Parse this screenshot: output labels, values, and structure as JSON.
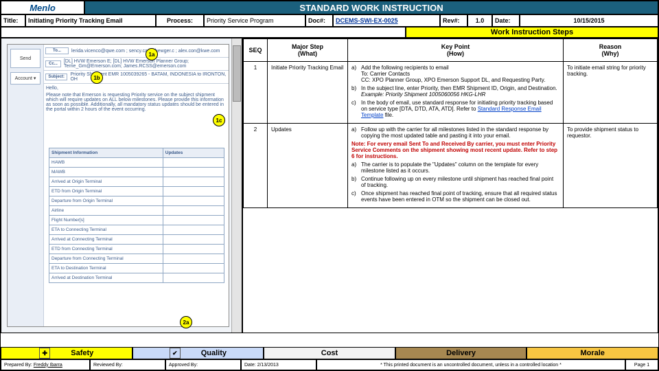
{
  "header": {
    "logo": "Menlo",
    "banner": "STANDARD WORK INSTRUCTION"
  },
  "meta": {
    "title_lbl": "Title:",
    "title": "Initiating Priority Tracking Email",
    "process_lbl": "Process:",
    "process": "Priority Service Program",
    "doc_lbl": "Doc#:",
    "doc": "DCEMS-SWI-EX-0025",
    "rev_lbl": "Rev#:",
    "rev": "1.0",
    "date_lbl": "Date:",
    "date": "10/15/2015"
  },
  "wis": "Work Instruction Steps",
  "cols": {
    "seq": "SEQ",
    "what": "Major Step\n(What)",
    "how": "Key Point\n(How)",
    "why": "Reason\n(Why)"
  },
  "steps": [
    {
      "seq": "1",
      "what": "Initiate Priority Tracking Email",
      "why": "To initiate email string for priority tracking.",
      "how": [
        {
          "l": "a)",
          "t": "Add the following recipients to email\nTo: Carrier Contacts\nCC: XPO Planner Group, XPO Emerson Support DL, and Requesting Party."
        },
        {
          "l": "b)",
          "t": "In the subject line, enter Priority, then EMR Shipment ID, Origin, and Destination.",
          "ex": "Example: Priority Shipment 1005060056 HKG-LHR"
        },
        {
          "l": "c)",
          "t": "In the body of email, use standard response for initiating priority tracking based on service type [DTA, DTD, ATA, ATD]. Refer to ",
          "link": "Standard Response Email Template",
          "t2": " file."
        }
      ]
    },
    {
      "seq": "2",
      "what": "Updates",
      "why": "To provide shipment status to requestor.",
      "how": [
        {
          "l": "a)",
          "t": "Follow up with the carrier for all milestones listed in the standard response by copying the most updated table and pasting it into your email."
        },
        {
          "note": "Note: For every email Sent To and Received By carrier, you must enter Priority Service Comments on the shipment showing most recent update. Refer to step 6 for instructions."
        },
        {
          "l": "a)",
          "t": "The carrier is to populate the \"Updates\" column on the template for every milestone listed as it occurs."
        },
        {
          "l": "b)",
          "t": "Continue following up on every milestone until shipment has reached final point of tracking."
        },
        {
          "l": "c)",
          "t": "Once shipment has reached final point of tracking, ensure that all required status events have been entered in OTM so the shipment can be closed out."
        }
      ]
    }
  ],
  "email": {
    "send": "Send",
    "acct": "Account ▾",
    "to_lbl": "To...",
    "cc_lbl": "Cc...",
    "subj_lbl": "Subject:",
    "to": "lerida.vicenco@qwe.com ; sency.cap@hewger.c ; alex.con@kwe.com",
    "cc": "[DL] HVW Emerson E; [DL] HVW Emerson Planner Group; Terrie_Gm@Emerson.com; James.RCSS@emerson.com",
    "subj": "Priority Shipment EMR 1005039265 - BATAM, INDONESIA to IRONTON, OH",
    "greet": "Hello,",
    "body1": "Please note that Emerson is requesting Priority service on the subject shipment which will require updates on ALL below milestones. Please provide this information as soon as possible. Additionally, all mandatory status updates should be entered in the portal within 2 hours of the event occurring.",
    "mh1": "Shipment Information",
    "mh2": "Updates",
    "ms": [
      "HAWB",
      "MAWB",
      "Arrived at Origin Terminal",
      "ETD from Origin Terminal",
      "Departure from Origin Terminal",
      "Airline",
      "Flight Number[s]",
      "ETA to Connecting Terminal",
      "Arrived at Connecting Terminal",
      "ETD from Connecting Terminal",
      "Departure from Connecting Terminal",
      "ETA to Destination Terminal",
      "Arrived at Destination Terminal"
    ]
  },
  "callouts": {
    "c1a": "1a",
    "c1b": "1b",
    "c1c": "1c",
    "c2a": "2a"
  },
  "pillars": {
    "s": "Safety",
    "q": "Quality",
    "c": "Cost",
    "d": "Delivery",
    "m": "Morale"
  },
  "sig": {
    "prep_l": "Prepared By:",
    "prep": "Freddy Ibarra",
    "rev_l": "Reviewed By:",
    "app_l": "Approved By:",
    "dt_l": "Date:",
    "dt": "2/13/2013",
    "disc": "* This printed document is an uncontrolled document, unless in a controlled location *",
    "page": "Page 1"
  },
  "icons": {
    "plus": "✚",
    "check": "✔"
  }
}
